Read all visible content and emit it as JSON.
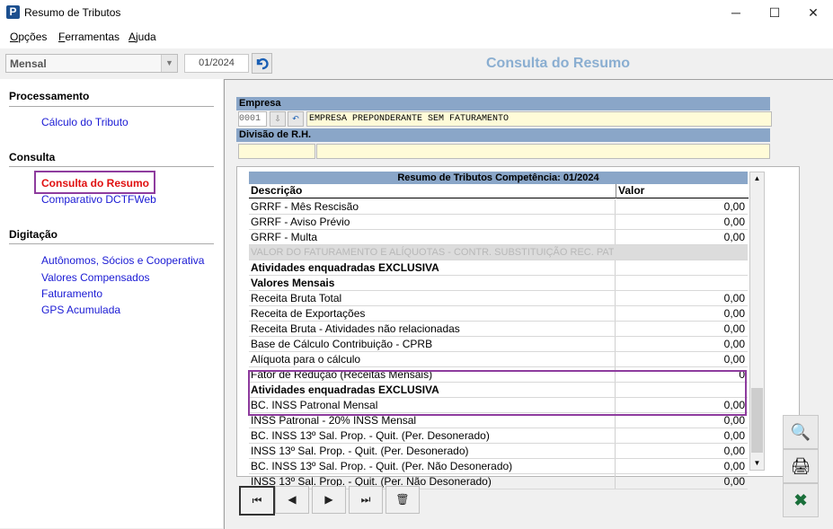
{
  "window": {
    "title": "Resumo de Tributos",
    "app_icon": "P",
    "minimize": "─",
    "maximize": "☐",
    "close": "✕"
  },
  "menu": [
    {
      "u": "O",
      "rest": "pções"
    },
    {
      "u": "F",
      "rest": "erramentas"
    },
    {
      "u": "A",
      "rest": "juda"
    }
  ],
  "toolbar": {
    "period_type": "Mensal",
    "period": "01/2024"
  },
  "header": {
    "title": "Consulta do Resumo"
  },
  "sidebar": {
    "sections": [
      {
        "title": "Processamento",
        "items": [
          "Cálculo do Tributo"
        ]
      },
      {
        "title": "Consulta",
        "items": [
          "Consulta do Resumo",
          "Comparativo DCTFWeb"
        ]
      },
      {
        "title": "Digitação",
        "items": [
          "Autônomos, Sócios e Cooperativa",
          "Valores Compensados",
          "Faturamento",
          "GPS Acumulada"
        ]
      }
    ]
  },
  "empresa": {
    "label": "Empresa",
    "code": "0001",
    "name": "EMPRESA PREPONDERANTE SEM FATURAMENTO",
    "division_label": "Divisão de R.H."
  },
  "grid": {
    "title": "Resumo de Tributos Competência: 01/2024",
    "col_desc": "Descrição",
    "col_val": "Valor",
    "rows": [
      {
        "d": "GRRF - Mês Rescisão",
        "v": "0,00",
        "t": ""
      },
      {
        "d": "GRRF - Aviso Prévio",
        "v": "0,00",
        "t": ""
      },
      {
        "d": "GRRF - Multa",
        "v": "0,00",
        "t": ""
      },
      {
        "d": "VALOR DO FATURAMENTO E ALÍQUOTAS - CONTR. SUBSTITUIÇÃO REC. PATRONAL",
        "v": "",
        "t": "grey"
      },
      {
        "d": "Atividades enquadradas EXCLUSIVA",
        "v": "",
        "t": "bold"
      },
      {
        "d": "Valores Mensais",
        "v": "",
        "t": "bold"
      },
      {
        "d": "Receita Bruta Total",
        "v": "0,00",
        "t": ""
      },
      {
        "d": "Receita de Exportações",
        "v": "0,00",
        "t": ""
      },
      {
        "d": "Receita Bruta - Atividades não relacionadas",
        "v": "0,00",
        "t": ""
      },
      {
        "d": "Base de Cálculo Contribuição - CPRB",
        "v": "0,00",
        "t": ""
      },
      {
        "d": "Alíquota para o cálculo",
        "v": "0,00",
        "t": ""
      },
      {
        "d": "Fator de Redução (Receitas Mensais)",
        "v": "0",
        "t": ""
      },
      {
        "d": "Atividades enquadradas EXCLUSIVA",
        "v": "",
        "t": "bold"
      },
      {
        "d": "BC. INSS Patronal Mensal",
        "v": "0,00",
        "t": ""
      },
      {
        "d": "INSS Patronal - 20% INSS Mensal",
        "v": "0,00",
        "t": ""
      },
      {
        "d": "BC. INSS 13º Sal. Prop. - Quit. (Per. Desonerado)",
        "v": "0,00",
        "t": ""
      },
      {
        "d": "INSS 13º Sal. Prop. - Quit. (Per. Desonerado)",
        "v": "0,00",
        "t": ""
      },
      {
        "d": "BC. INSS 13º Sal. Prop. - Quit. (Per. Não Desonerado)",
        "v": "0,00",
        "t": ""
      },
      {
        "d": "INSS 13º Sal. Prop. - Quit. (Per. Não Desonerado)",
        "v": "0,00",
        "t": ""
      }
    ]
  },
  "icons": {
    "combo_arrow": "chevron-down-icon",
    "refresh": "refresh-icon",
    "nav": [
      "first-record-icon",
      "previous-icon",
      "next-icon",
      "last-record-icon",
      "delete-icon"
    ],
    "tools": [
      "search-icon",
      "print-icon",
      "exit-icon"
    ]
  },
  "colors": {
    "accent": "#8aa6c8",
    "header_title": "#8aaed1",
    "active_link": "#e01010",
    "link": "#1a1ad4",
    "highlight_box": "#8e3c9e",
    "field_bg": "#fffbd8"
  }
}
